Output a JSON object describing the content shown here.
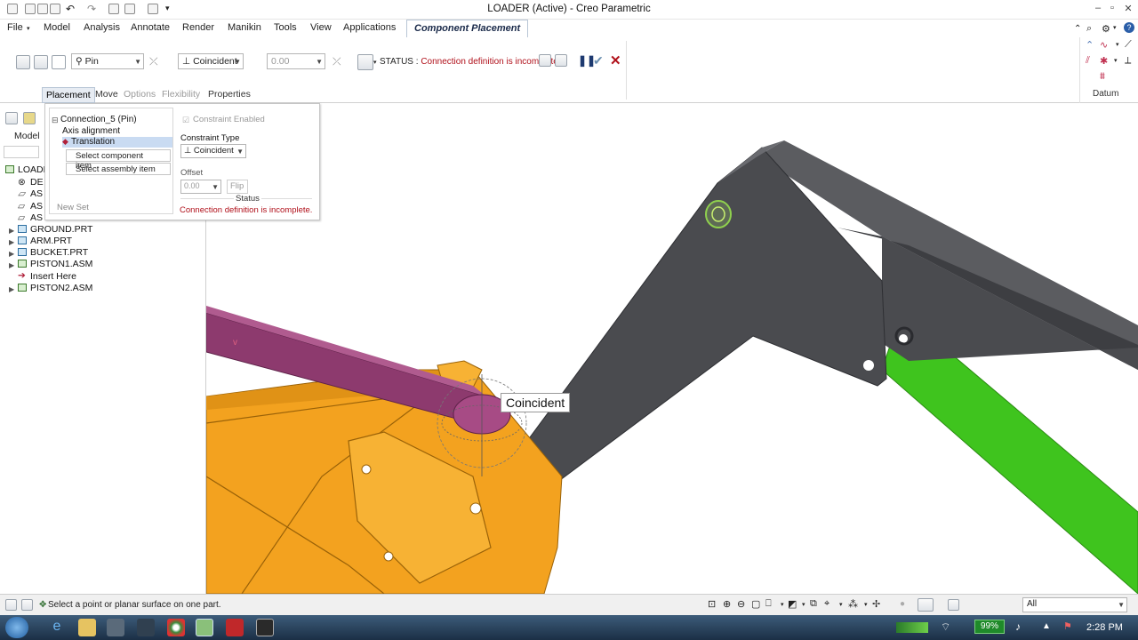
{
  "window": {
    "title": "LOADER (Active) - Creo Parametric"
  },
  "ribbon_tabs": [
    "File",
    "Model",
    "Analysis",
    "Annotate",
    "Render",
    "Manikin",
    "Tools",
    "View",
    "Applications",
    "Component Placement"
  ],
  "dashboard": {
    "connection_type": "Pin",
    "constraint_type": "Coincident",
    "offset_value": "0.00",
    "status_label": "STATUS :",
    "status_message": "Connection definition is incomplete."
  },
  "subtabs": [
    "Placement",
    "Move",
    "Options",
    "Flexibility",
    "Properties"
  ],
  "datum_group_label": "Datum",
  "placement_panel": {
    "connection": "Connection_5 (Pin)",
    "sets": [
      "Axis alignment",
      "Translation"
    ],
    "select_component": "Select component item",
    "select_assembly": "Select assembly item",
    "new_set": "New Set",
    "constraint_enabled": "Constraint Enabled",
    "constraint_type_label": "Constraint Type",
    "constraint_type_value": "Coincident",
    "offset_label": "Offset",
    "offset_value": "0.00",
    "flip_label": "Flip",
    "status_label": "Status",
    "status_message": "Connection definition is incomplete."
  },
  "model_tree": {
    "tab_label": "Model",
    "items": [
      "LOADE",
      "DE",
      "AS",
      "AS",
      "AS",
      "GROUND.PRT",
      "ARM.PRT",
      "BUCKET.PRT",
      "PISTON1.ASM",
      "Insert Here",
      "PISTON2.ASM"
    ]
  },
  "viewport": {
    "callout": "Coincident"
  },
  "status_bar": {
    "message": "Select a point or planar surface on one part.",
    "filter": "All"
  },
  "taskbar": {
    "battery": "99%",
    "clock": "2:28 PM"
  },
  "colors": {
    "bucket": "#f3a21f",
    "arm": "#4a4b4f",
    "piston1": "#8d3a6e",
    "piston2": "#3fc41e",
    "status_red": "#b0101a"
  }
}
